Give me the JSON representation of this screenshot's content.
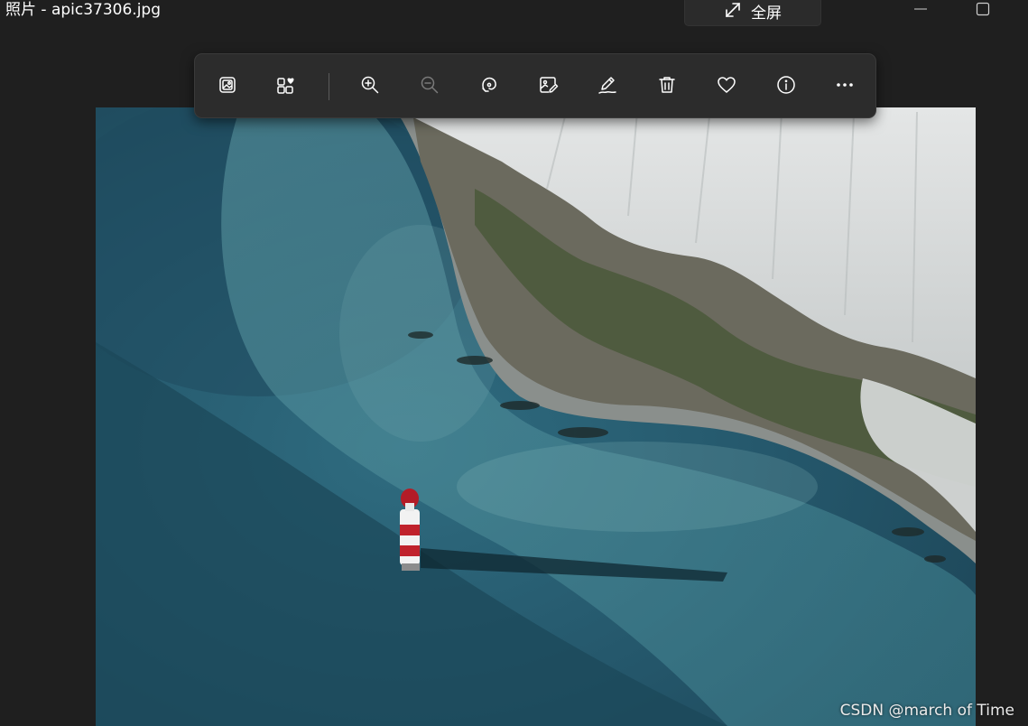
{
  "window": {
    "title": "照片 - apic37306.jpg"
  },
  "titlebar": {
    "fullscreen_label": "全屏",
    "minimize_icon": "minimize-icon",
    "maximize_icon": "maximize-icon"
  },
  "toolbar": {
    "items": [
      {
        "icon": "gallery-image-icon"
      },
      {
        "icon": "collection-favorite-icon"
      },
      {
        "icon": "zoom-in-icon"
      },
      {
        "icon": "zoom-out-icon",
        "disabled": true
      },
      {
        "icon": "rotate-icon"
      },
      {
        "icon": "edit-image-icon"
      },
      {
        "icon": "draw-icon"
      },
      {
        "icon": "delete-icon"
      },
      {
        "icon": "favorite-heart-icon"
      },
      {
        "icon": "info-icon"
      },
      {
        "icon": "more-icon"
      }
    ]
  },
  "photo": {
    "subject": "aerial-lighthouse-cliffs"
  },
  "watermark": "CSDN @march of Time",
  "colors": {
    "background": "#1f1f1f",
    "toolbar_bg": "#2c2c2c",
    "icon": "#ffffff",
    "icon_disabled": "#7a7a7a"
  }
}
